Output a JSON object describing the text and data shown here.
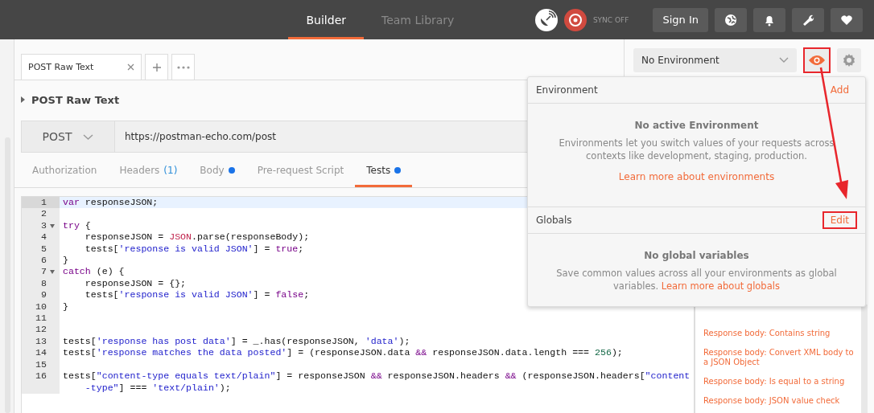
{
  "header": {
    "tabs": [
      {
        "label": "Builder",
        "selected": true
      },
      {
        "label": "Team Library",
        "selected": false
      }
    ],
    "sync_label": "SYNC OFF",
    "sign_in": "Sign In"
  },
  "request_tabs": [
    {
      "label": "POST Raw Text",
      "selected": true
    }
  ],
  "request": {
    "name": "POST Raw Text",
    "method": "POST",
    "url": "https://postman-echo.com/post"
  },
  "sub_tabs": [
    {
      "label": "Authorization",
      "selected": false,
      "dot": false
    },
    {
      "label": "Headers",
      "count": "(1)",
      "selected": false,
      "dot": false
    },
    {
      "label": "Body",
      "selected": false,
      "dot": true
    },
    {
      "label": "Pre-request Script",
      "selected": false,
      "dot": false
    },
    {
      "label": "Tests",
      "selected": true,
      "dot": true
    }
  ],
  "editor": {
    "lines": [
      {
        "number": "1",
        "active": true,
        "foldable": false,
        "tokens": [
          {
            "kind": "keyword",
            "text": "var"
          },
          {
            "kind": "plain",
            "text": " responseJSON;"
          }
        ]
      },
      {
        "number": "2",
        "active": false,
        "foldable": false
      },
      {
        "number": "3",
        "active": false,
        "foldable": true,
        "tokens": [
          {
            "kind": "keyword",
            "text": "try"
          },
          {
            "kind": "plain",
            "text": " {"
          }
        ]
      },
      {
        "number": "4",
        "active": false,
        "foldable": false,
        "tokens": [
          {
            "kind": "plain",
            "text": "    responseJSON = "
          },
          {
            "kind": "builtin",
            "text": "JSON"
          },
          {
            "kind": "plain",
            "text": ".parse(responseBody);"
          }
        ]
      },
      {
        "number": "5",
        "active": false,
        "foldable": false,
        "tokens": [
          {
            "kind": "plain",
            "text": "    tests["
          },
          {
            "kind": "string",
            "text": "'response is valid JSON'"
          },
          {
            "kind": "plain",
            "text": "] = "
          },
          {
            "kind": "keyword",
            "text": "true"
          },
          {
            "kind": "plain",
            "text": ";"
          }
        ]
      },
      {
        "number": "6",
        "active": false,
        "foldable": false,
        "tokens": [
          {
            "kind": "plain",
            "text": "}"
          }
        ]
      },
      {
        "number": "7",
        "active": false,
        "foldable": true,
        "tokens": [
          {
            "kind": "keyword",
            "text": "catch"
          },
          {
            "kind": "plain",
            "text": " (e) {"
          }
        ]
      },
      {
        "number": "8",
        "active": false,
        "foldable": false,
        "tokens": [
          {
            "kind": "plain",
            "text": "    responseJSON = {};"
          }
        ]
      },
      {
        "number": "9",
        "active": false,
        "foldable": false,
        "tokens": [
          {
            "kind": "plain",
            "text": "    tests["
          },
          {
            "kind": "string",
            "text": "'response is valid JSON'"
          },
          {
            "kind": "plain",
            "text": "] = "
          },
          {
            "kind": "keyword",
            "text": "false"
          },
          {
            "kind": "plain",
            "text": ";"
          }
        ]
      },
      {
        "number": "10",
        "active": false,
        "foldable": false,
        "tokens": [
          {
            "kind": "plain",
            "text": "}"
          }
        ]
      },
      {
        "number": "11",
        "active": false,
        "foldable": false
      },
      {
        "number": "12",
        "active": false,
        "foldable": false
      },
      {
        "number": "13",
        "active": false,
        "foldable": false,
        "tokens": [
          {
            "kind": "plain",
            "text": "tests["
          },
          {
            "kind": "string",
            "text": "'response has post data'"
          },
          {
            "kind": "plain",
            "text": "] = _.has(responseJSON, "
          },
          {
            "kind": "string",
            "text": "'data'"
          },
          {
            "kind": "plain",
            "text": ");"
          }
        ]
      },
      {
        "number": "14",
        "active": false,
        "foldable": false,
        "tokens": [
          {
            "kind": "plain",
            "text": "tests["
          },
          {
            "kind": "string",
            "text": "'response matches the data posted'"
          },
          {
            "kind": "plain",
            "text": "] = (responseJSON.data "
          },
          {
            "kind": "keyword",
            "text": "&&"
          },
          {
            "kind": "plain",
            "text": " responseJSON.data.length === "
          },
          {
            "kind": "number",
            "text": "256"
          },
          {
            "kind": "plain",
            "text": ");"
          }
        ]
      },
      {
        "number": "15",
        "active": false,
        "foldable": false
      },
      {
        "number": "16",
        "active": false,
        "foldable": false,
        "tokens": [
          {
            "kind": "plain",
            "text": "tests["
          },
          {
            "kind": "string",
            "text": "\"content-type equals text/plain\""
          },
          {
            "kind": "plain",
            "text": "] = responseJSON "
          },
          {
            "kind": "keyword",
            "text": "&&"
          },
          {
            "kind": "plain",
            "text": " responseJSON.headers "
          },
          {
            "kind": "keyword",
            "text": "&&"
          },
          {
            "kind": "plain",
            "text": " (responseJSON.headers["
          },
          {
            "kind": "string",
            "text": "\"content"
          }
        ],
        "continuation": [
          {
            "kind": "string",
            "text": "-type\""
          },
          {
            "kind": "plain",
            "text": "] === "
          },
          {
            "kind": "string",
            "text": "'text/plain'"
          },
          {
            "kind": "plain",
            "text": ");"
          }
        ]
      }
    ]
  },
  "environment": {
    "selected": "No Environment",
    "quick_look_highlighted": true
  },
  "popover": {
    "environment_title": "Environment",
    "add": "Add",
    "env_empty_title": "No active Environment",
    "env_empty_text": "Environments let you switch values of your requests across contexts like development, staging, production.",
    "env_link": "Learn more about environments",
    "globals_title": "Globals",
    "edit": "Edit",
    "edit_highlighted": true,
    "globals_empty_title": "No global variables",
    "globals_empty_text": "Save common values across all your environments as global variables.",
    "globals_link": "Learn more about globals"
  },
  "snippets": [
    "Response body: Contains string",
    "Response body: Convert XML body to a JSON Object",
    "Response body: Is equal to a string",
    "Response body: JSON value check"
  ]
}
